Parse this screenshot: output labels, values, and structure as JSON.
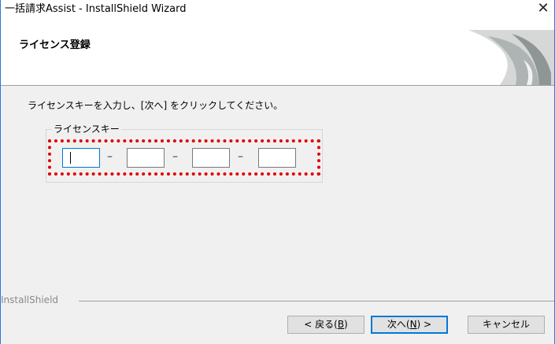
{
  "window": {
    "title": "一括請求Assist - InstallShield Wizard",
    "close_glyph": "✕"
  },
  "header": {
    "heading": "ライセンス登録"
  },
  "content": {
    "instruction": "ライセンスキーを入力し、[次へ] をクリックしてください。",
    "groupbox_label": "ライセンスキー",
    "key_fields": [
      {
        "value": ""
      },
      {
        "value": ""
      },
      {
        "value": ""
      },
      {
        "value": ""
      }
    ],
    "separator": "–",
    "highlight_color": "#e00000"
  },
  "footer": {
    "brand": "InstallShield",
    "buttons": {
      "back": {
        "prefix": "< 戻る(",
        "mnemonic": "B",
        "suffix": ")"
      },
      "next": {
        "prefix": "次へ(",
        "mnemonic": "N",
        "suffix": ") >"
      },
      "cancel": {
        "label": "キャンセル"
      }
    }
  },
  "colors": {
    "window_bg": "#f0f0f0",
    "focus_accent": "#0078d7"
  }
}
